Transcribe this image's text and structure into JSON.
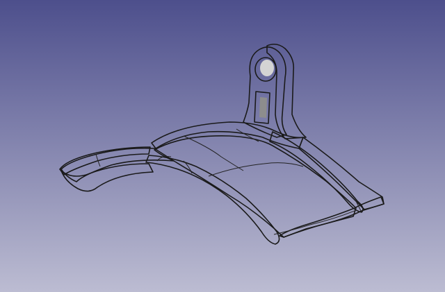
{
  "view": {
    "background_top": "#4d4f8c",
    "background_bottom": "#bcbcd2",
    "part_color": "#a8a8a8",
    "edge_color": "#1a1a1a"
  },
  "part": {
    "features": [
      "curved-base",
      "raised-rim",
      "mounting-tab",
      "tab-hole",
      "tab-slot"
    ]
  }
}
